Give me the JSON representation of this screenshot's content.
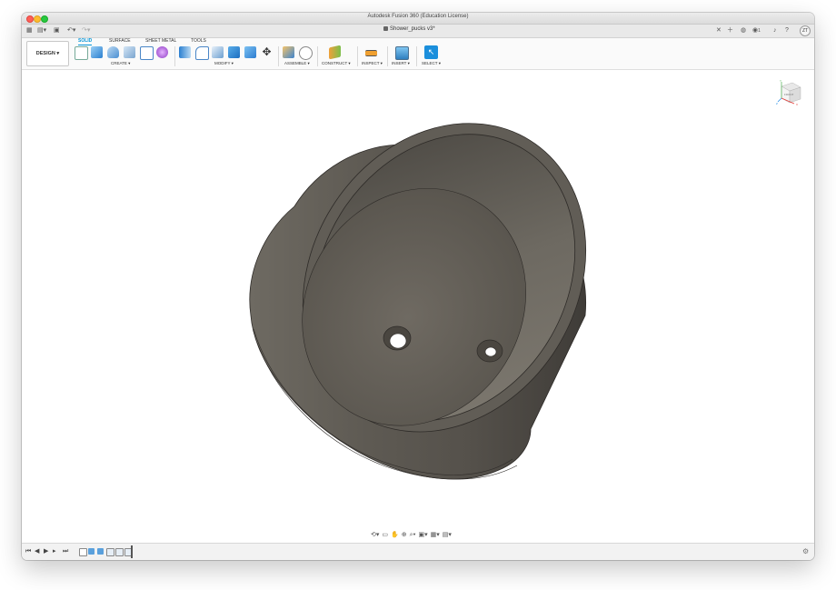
{
  "window": {
    "title": "Autodesk Fusion 360 (Education License)"
  },
  "tabs": {
    "document": "Shower_pucks v3*",
    "user_initials": "ZT",
    "job_count": "1"
  },
  "toolbar": {
    "workspace": "DESIGN",
    "ribbon_tabs": [
      "SOLID",
      "SURFACE",
      "SHEET METAL",
      "TOOLS"
    ],
    "active_tab": "SOLID",
    "groups": [
      "CREATE",
      "MODIFY",
      "ASSEMBLE",
      "CONSTRUCT",
      "INSPECT",
      "INSERT",
      "SELECT"
    ]
  },
  "viewcube": {
    "face": "FRONT",
    "axis_x": "X",
    "axis_y": "Y",
    "axis_z": "Z"
  },
  "model": {
    "description_color": "#5a564f",
    "inner_color": "#6a655d",
    "edge_color": "#2e2b28"
  },
  "colors": {
    "accent": "#0696d7",
    "select": "#1b8fdc"
  },
  "icons": {
    "grid_menu": "grid-icon",
    "file": "file-icon",
    "save": "save-icon",
    "undo": "undo-icon",
    "redo": "redo-icon",
    "close": "close-icon",
    "new_tab": "plus-icon",
    "extensions": "extensions-icon",
    "jobs": "jobs-icon",
    "notifications": "bell-icon",
    "help": "help-icon",
    "settings": "gear-icon"
  }
}
